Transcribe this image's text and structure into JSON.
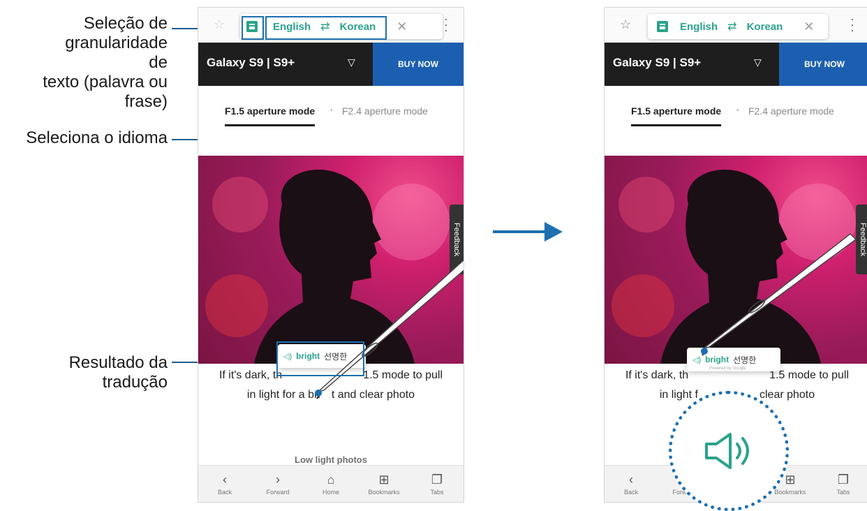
{
  "callouts": {
    "granularity": "Seleção de granularidade de texto (palavra ou frase)",
    "granularity_lines": [
      "Seleção de",
      "granularidade de",
      "texto (palavra ou",
      "frase)"
    ],
    "language": "Seleciona o idioma",
    "result_lines": [
      "Resultado da",
      "tradução"
    ]
  },
  "browser": {
    "translator": {
      "source_lang": "English",
      "target_lang": "Korean"
    },
    "header_title": "Galaxy S9 | S9+",
    "buy_button": "BUY NOW",
    "tabs": [
      "F1.5 aperture mode",
      "F2.4 aperture mode"
    ],
    "feedback_label": "Feedback",
    "body_line1_left": "If it's dark, th",
    "body_line1_right": "1.5 mode to pull",
    "body_line2_left": "in light for a bri",
    "body_line2_right": "t and clear photo",
    "body_line2_left_b": "in light f",
    "body_line2_right_b": "clear photo",
    "lowlight_heading": "Low light photos",
    "popup": {
      "source": "bright",
      "translation": "선명한",
      "credit": "Powered by Google"
    },
    "nav": [
      {
        "icon": "back-icon",
        "label": "Back"
      },
      {
        "icon": "forward-icon",
        "label": "Forward"
      },
      {
        "icon": "home-icon",
        "label": "Home"
      },
      {
        "icon": "bookmarks-icon",
        "label": "Bookmarks"
      },
      {
        "icon": "tabs-icon",
        "label": "Tabs"
      }
    ]
  },
  "colors": {
    "accent": "#2aa38b",
    "callout": "#1d6fb0",
    "buy": "#1c5fb0"
  }
}
